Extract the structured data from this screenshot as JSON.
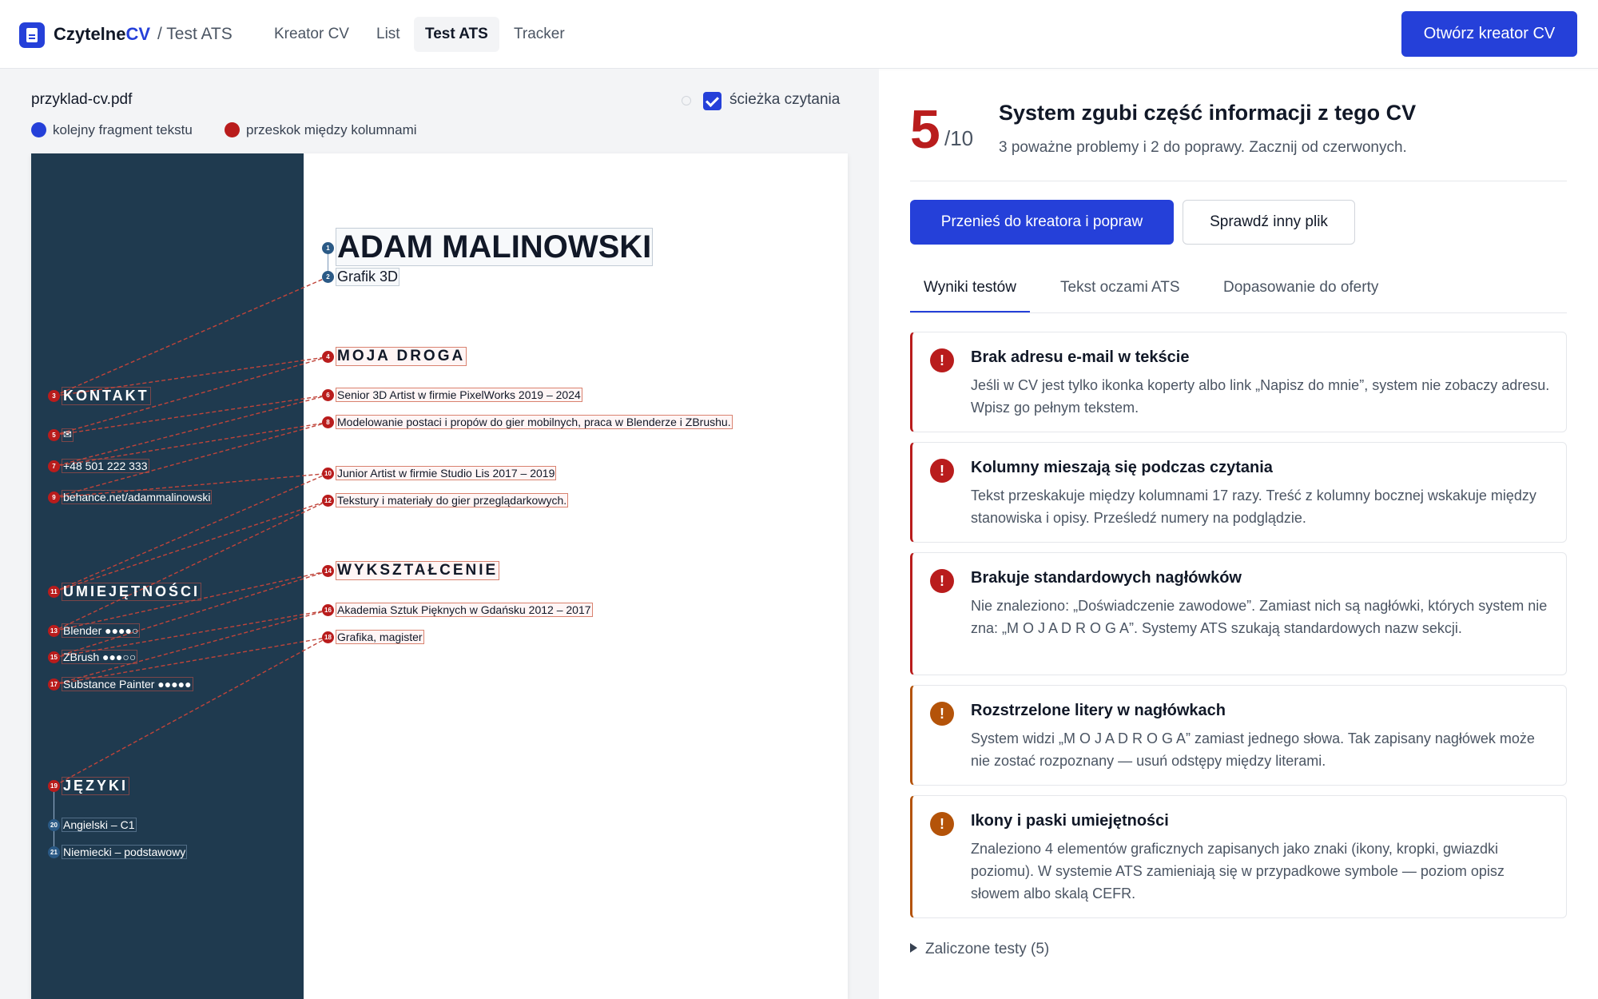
{
  "header": {
    "brand_main": "Czytelne",
    "brand_accent": "CV",
    "crumb": "/ Test ATS",
    "nav": [
      "Kreator CV",
      "List",
      "Test ATS",
      "Tracker"
    ],
    "cta": "Otwórz kreator CV"
  },
  "viewer": {
    "filename": "przyklad-cv.pdf",
    "path_toggle": "ścieżka czytania",
    "legend_next": "kolejny fragment tekstu",
    "legend_jump": "przeskok między kolumnami",
    "colors": {
      "sidebar": "#1f3a4f",
      "jump": "#b91c1c",
      "next": "#2b5a86"
    }
  },
  "cv": {
    "fragments": [
      {
        "n": "1",
        "text": "ADAM MALINOWSKI",
        "col": "main",
        "kind": "next"
      },
      {
        "n": "2",
        "text": "Grafik 3D",
        "col": "main",
        "kind": "next"
      },
      {
        "n": "3",
        "text": "KONTAKT",
        "col": "side",
        "kind": "jump"
      },
      {
        "n": "4",
        "text": "MOJA DROGA",
        "col": "main",
        "kind": "jump"
      },
      {
        "n": "5",
        "text": "✉",
        "col": "side",
        "kind": "jump"
      },
      {
        "n": "6",
        "text": "Senior 3D Artist w firmie PixelWorks 2019 – 2024",
        "col": "main",
        "kind": "jump"
      },
      {
        "n": "7",
        "text": "+48 501 222 333",
        "col": "side",
        "kind": "jump"
      },
      {
        "n": "8",
        "text": "Modelowanie postaci i propów do gier mobilnych, praca w Blenderze i ZBrushu.",
        "col": "main",
        "kind": "jump"
      },
      {
        "n": "9",
        "text": "behance.net/adammalinowski",
        "col": "side",
        "kind": "jump"
      },
      {
        "n": "10",
        "text": "Junior Artist w firmie Studio Lis 2017 – 2019",
        "col": "main",
        "kind": "jump"
      },
      {
        "n": "11",
        "text": "UMIEJĘTNOŚCI",
        "col": "side",
        "kind": "jump"
      },
      {
        "n": "12",
        "text": "Tekstury i materiały do gier przeglądarkowych.",
        "col": "main",
        "kind": "jump"
      },
      {
        "n": "13",
        "text": "Blender ●●●●○",
        "col": "side",
        "kind": "jump"
      },
      {
        "n": "14",
        "text": "WYKSZTAŁCENIE",
        "col": "main",
        "kind": "jump"
      },
      {
        "n": "15",
        "text": "ZBrush ●●●○○",
        "col": "side",
        "kind": "jump"
      },
      {
        "n": "16",
        "text": "Akademia Sztuk Pięknych w Gdańsku 2012 – 2017",
        "col": "main",
        "kind": "jump"
      },
      {
        "n": "17",
        "text": "Substance Painter ●●●●●",
        "col": "side",
        "kind": "jump"
      },
      {
        "n": "18",
        "text": "Grafika, magister",
        "col": "main",
        "kind": "jump"
      },
      {
        "n": "19",
        "text": "JĘZYKI",
        "col": "side",
        "kind": "jump"
      },
      {
        "n": "20",
        "text": "Angielski – C1",
        "col": "side",
        "kind": "next"
      },
      {
        "n": "21",
        "text": "Niemiecki – podstawowy",
        "col": "side",
        "kind": "next"
      }
    ]
  },
  "result": {
    "score": "5",
    "score_max": "/10",
    "title": "System zgubi część informacji z tego CV",
    "subtitle": "3 poważne problemy i 2 do poprawy. Zacznij od czerwonych.",
    "btn_primary": "Przenieś do kreatora i popraw",
    "btn_secondary": "Sprawdź inny plik",
    "tabs": [
      "Wyniki testów",
      "Tekst oczami ATS",
      "Dopasowanie do oferty"
    ],
    "issues": [
      {
        "severity": "red",
        "icon": "!",
        "title": "Brak adresu e-mail w tekście",
        "desc": "Jeśli w CV jest tylko ikonka koperty albo link „Napisz do mnie”, system nie zobaczy adresu. Wpisz go pełnym tekstem."
      },
      {
        "severity": "red",
        "icon": "!",
        "title": "Kolumny mieszają się podczas czytania",
        "desc": "Tekst przeskakuje między kolumnami 17 razy. Treść z kolumny bocznej wskakuje między stanowiska i opisy. Prześledź numery na podglądzie."
      },
      {
        "severity": "red",
        "icon": "!",
        "title": "Brakuje standardowych nagłówków",
        "desc": "Nie znaleziono: „Doświadczenie zawodowe”. Zamiast nich są nagłówki, których system nie zna: „M O J A D R O G A”. Systemy ATS szukają standardowych nazw sekcji."
      },
      {
        "severity": "orange",
        "icon": "!",
        "title": "Rozstrzelone litery w nagłówkach",
        "desc": "System widzi „M O J A D R O G A” zamiast jednego słowa. Tak zapisany nagłówek może nie zostać rozpoznany — usuń odstępy między literami."
      },
      {
        "severity": "orange",
        "icon": "!",
        "title": "Ikony i paski umiejętności",
        "desc": "Znaleziono 4 elementów graficznych zapisanych jako znaki (ikony, kropki, gwiazdki poziomu). W systemie ATS zamieniają się w przypadkowe symbole — poziom opisz słowem albo skalą CEFR."
      }
    ],
    "passed": "Zaliczone testy (5)"
  }
}
